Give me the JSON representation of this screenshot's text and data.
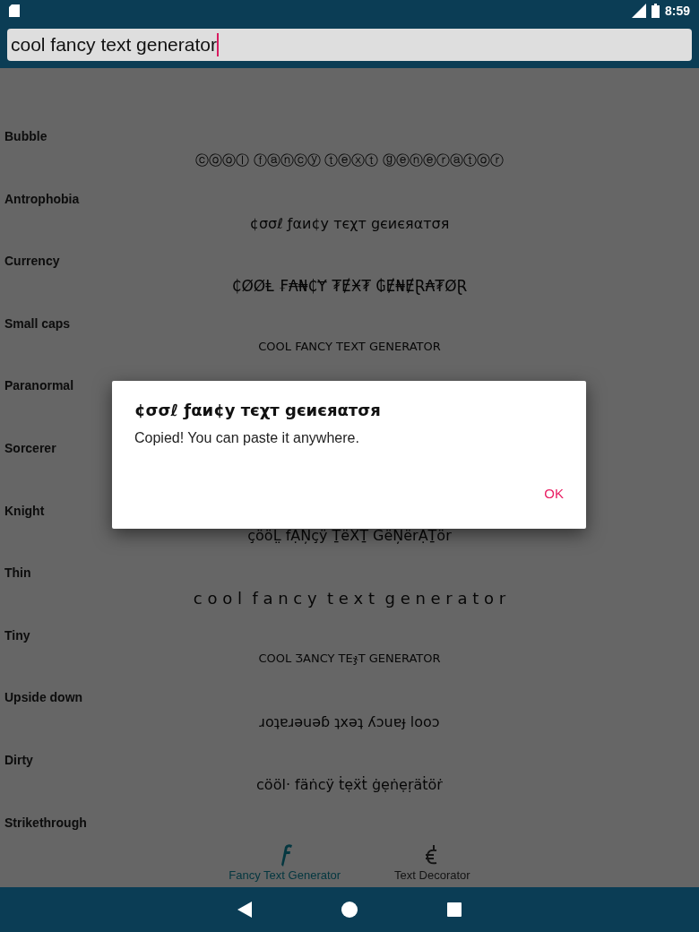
{
  "status_bar": {
    "time": "8:59"
  },
  "search": {
    "value": "cool fancy text generator"
  },
  "styles": [
    {
      "name": "Bubble",
      "text": "ⓒⓞⓞⓛ ⓕⓐⓝⓒⓨ ⓣⓔⓧⓣ ⓖⓔⓝⓔⓡⓐⓣⓞⓡ"
    },
    {
      "name": "Antrophobia",
      "text": "¢σσℓ ƒαи¢у тєχт gєиєяαтσя"
    },
    {
      "name": "Currency",
      "text": "₵ØØⱠ ₣₳₦₵Ɏ ₮ɆӾ₮ ₲Ɇ₦ɆⱤ₳₮ØⱤ"
    },
    {
      "name": "Small caps",
      "text": "COOL FANCY TEXT GENERATOR"
    },
    {
      "name": "Paranormal"
    },
    {
      "name": "Sorcerer"
    },
    {
      "name": "Knight",
      "text": "çööL̤ fẠŅçÿ ṮëẊṮ GëŅërẠṮör"
    },
    {
      "name": "Thin",
      "text": "c o o l  f a n c y  t e x t  g e n e r a t o r"
    },
    {
      "name": "Tiny",
      "text": "COOL ƷANCY TEჯT GENERATOR"
    },
    {
      "name": "Upside down",
      "text": "ɹoʇɐɹǝuǝɓ ʇxǝʇ ʎɔuɐɟ looɔ"
    },
    {
      "name": "Dirty",
      "text": "cööl· fäṅcÿ ṫẹẍṫ ġẹṅẹṛäṫöṙ"
    },
    {
      "name": "Strikethrough"
    }
  ],
  "bottom_tabs": [
    {
      "label": "Fancy Text Generator",
      "selected": true
    },
    {
      "label": "Text Decorator",
      "selected": false
    }
  ],
  "dialog": {
    "title": "¢σσℓ ƒαи¢у тєχт gєиєяαтσя",
    "message": "Copied! You can paste it anywhere.",
    "button": "OK"
  }
}
